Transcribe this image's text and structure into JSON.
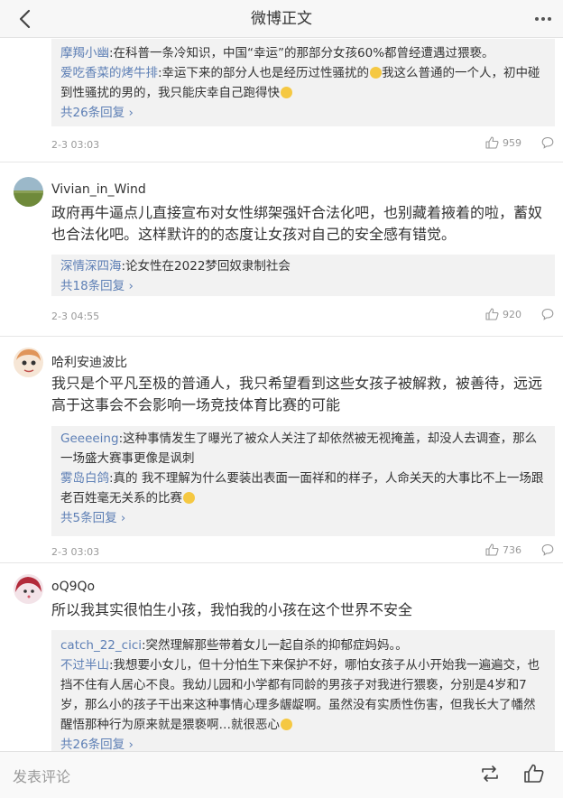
{
  "header": {
    "title": "微博正文"
  },
  "comments": [
    {
      "replies": [
        {
          "name": "摩羯小幽",
          "text": ":在科普一条冷知识，中国“幸运”的那部分女孩60%都曾经遭遇过猥亵。"
        },
        {
          "name": "爱吃香菜的烤牛排",
          "text": ":幸运下来的部分人也是经历过性骚扰的",
          "text2": "我这么普通的一个人，初中碰到性骚扰的男的，我只能庆幸自己跑得快"
        }
      ],
      "reply_count": "共26条回复",
      "time": "2-3 03:03",
      "likes": "959"
    },
    {
      "username": "Vivian_in_Wind",
      "text": "政府再牛逼点儿直接宣布对女性绑架强奸合法化吧，也别藏着掖着的啦，蓄奴也合法化吧。这样默许的的态度让女孩对自己的安全感有错觉。",
      "replies": [
        {
          "name": "深情深四海",
          "text": ":论女性在2022梦回奴隶制社会"
        }
      ],
      "reply_count": "共18条回复",
      "time": "2-3 04:55",
      "likes": "920"
    },
    {
      "username": "哈利安迪波比",
      "text": "我只是个平凡至极的普通人，我只希望看到这些女孩子被解救，被善待，远远高于这事会不会影响一场竞技体育比赛的可能",
      "replies": [
        {
          "name": "Geeeeing",
          "text": ":这种事情发生了曝光了被众人关注了却依然被无视掩盖，却没人去调查，那么一场盛大赛事更像是讽刺"
        },
        {
          "name": "雾岛白鸽",
          "text": ":真的 我不理解为什么要装出表面一面祥和的样子，人命关天的大事比不上一场跟老百姓毫无关系的比赛"
        }
      ],
      "reply_count": "共5条回复",
      "time": "2-3 03:03",
      "likes": "736"
    },
    {
      "username": "oQ9Qo",
      "text": "所以我其实很怕生小孩，我怕我的小孩在这个世界不安全",
      "replies": [
        {
          "name": "catch_22_cici",
          "text": ":突然理解那些带着女儿一起自杀的抑郁症妈妈。。"
        },
        {
          "name": "不过半山",
          "text": ":我想要小女儿，但十分怕生下来保护不好，哪怕女孩子从小开始我一遍遍交，也挡不住有人居心不良。我幼儿园和小学都有同龄的男孩子对我进行猥亵，分别是4岁和7岁，那么小的孩子干出来这种事情心理多龌龊啊。虽然没有实质性伤害，但我长大了幡然醒悟那种行为原来就是猥亵啊…就很恶心"
        }
      ],
      "reply_count": "共26条回复"
    }
  ],
  "footer": {
    "placeholder": "发表评论"
  },
  "colors": {
    "link": "#5d7fb5",
    "background": "#ffffff",
    "replies_bg": "#f2f2f2"
  },
  "icons": [
    "back-arrow-icon",
    "more-dots-icon",
    "thumbs-up-icon",
    "reply-bubble-icon",
    "repost-icon",
    "like-icon"
  ]
}
